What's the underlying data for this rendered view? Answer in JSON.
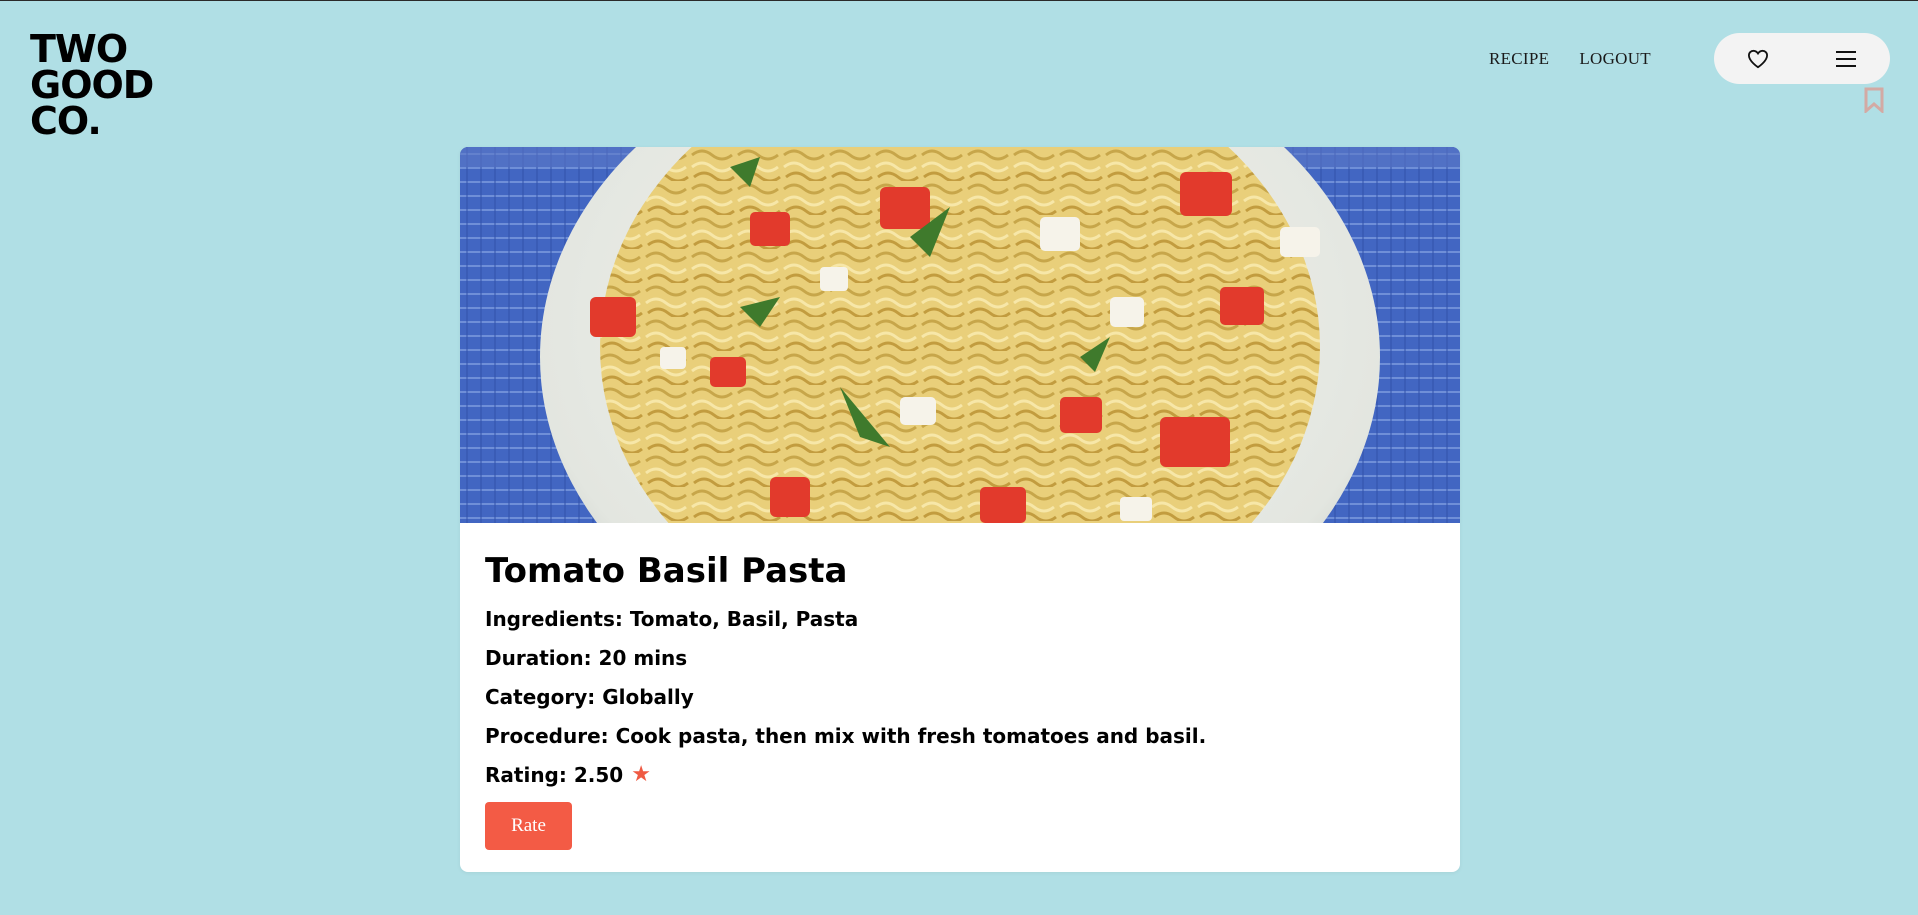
{
  "brand": {
    "logo_lines": [
      "TWO",
      "GOOD",
      "CO."
    ]
  },
  "nav": {
    "items": [
      "RECIPE",
      "LOGOUT"
    ]
  },
  "header_icons": [
    "heart-icon",
    "menu-icon",
    "bookmark-icon"
  ],
  "recipe": {
    "title": "Tomato Basil Pasta",
    "ingredients": "Ingredients: Tomato, Basil, Pasta",
    "duration": "Duration: 20 mins",
    "category": "Category: Globally",
    "procedure": "Procedure: Cook pasta, then mix with fresh tomatoes and basil.",
    "rating": "Rating: 2.50",
    "rate_label": "Rate"
  },
  "colors": {
    "background": "#b0dfe5",
    "accent": "#f35b45",
    "card": "#ffffff"
  }
}
